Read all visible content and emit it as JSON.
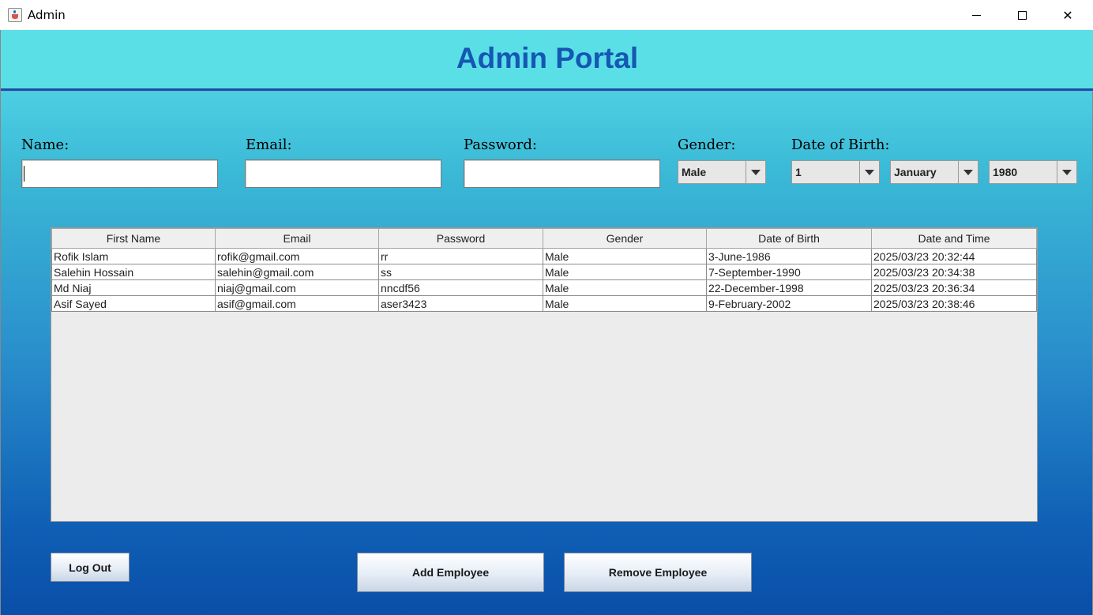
{
  "window": {
    "title": "Admin",
    "controls": {
      "minimize": "minimize-icon",
      "maximize": "maximize-icon",
      "close": "close-icon",
      "close_glyph": "✕"
    }
  },
  "header": {
    "title": "Admin Portal"
  },
  "form": {
    "name_label": "Name:",
    "email_label": "Email:",
    "password_label": "Password:",
    "gender_label": "Gender:",
    "dob_label": "Date of Birth:",
    "name_value": "",
    "email_value": "",
    "password_value": "",
    "gender_selected": "Male",
    "day_selected": "1",
    "month_selected": "January",
    "year_selected": "1980"
  },
  "table": {
    "columns": [
      "First Name",
      "Email",
      "Password",
      "Gender",
      "Date of Birth",
      "Date and Time"
    ],
    "rows": [
      [
        "Rofik Islam",
        "rofik@gmail.com",
        "rr",
        "Male",
        "3-June-1986",
        "2025/03/23 20:32:44"
      ],
      [
        "Salehin Hossain",
        "salehin@gmail.com",
        "ss",
        "Male",
        "7-September-1990",
        "2025/03/23 20:34:38"
      ],
      [
        "Md Niaj",
        "niaj@gmail.com",
        "nncdf56",
        "Male",
        "22-December-1998",
        "2025/03/23 20:36:34"
      ],
      [
        "Asif Sayed",
        "asif@gmail.com",
        "aser3423",
        "Male",
        "9-February-2002",
        "2025/03/23 20:38:46"
      ]
    ]
  },
  "buttons": {
    "logout": "Log Out",
    "add": "Add Employee",
    "remove": "Remove Employee"
  },
  "colors": {
    "header_bg": "#5adfe7",
    "title_color": "#1557b3",
    "gradient_bottom": "#0a4ea8"
  }
}
